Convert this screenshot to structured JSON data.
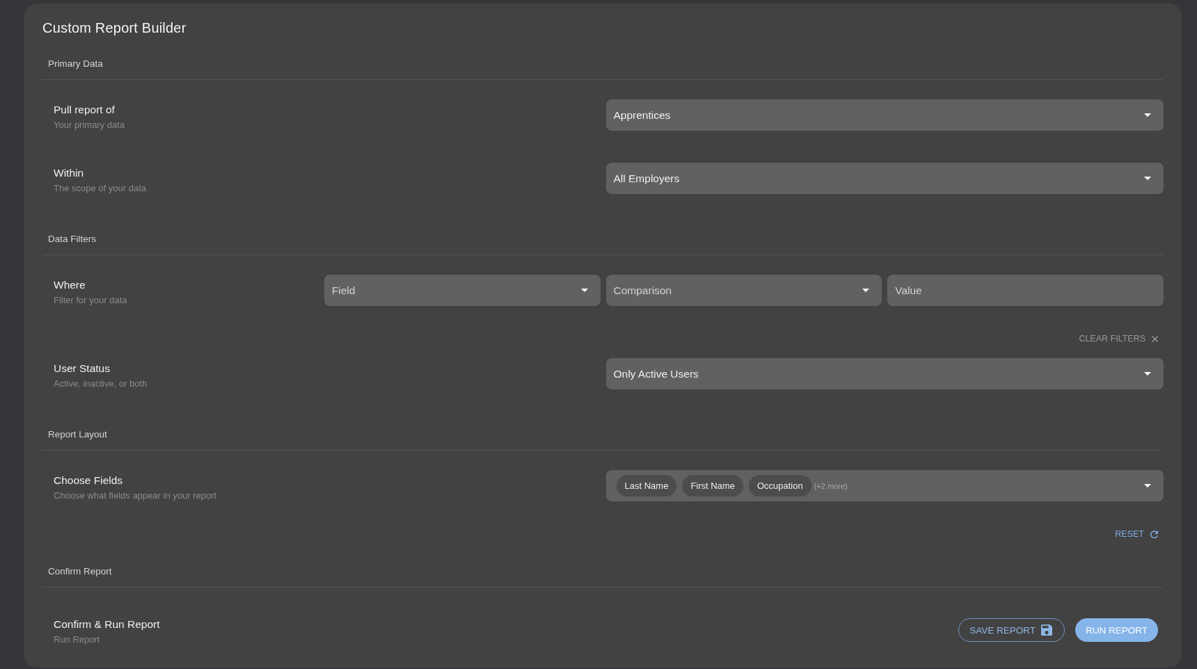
{
  "title": "Custom Report Builder",
  "sections": [
    {
      "heading": "Primary Data",
      "rows": [
        {
          "label": "Pull report of",
          "description": "Your primary data",
          "controls": [
            {
              "kind": "select",
              "value": "Apprentices"
            }
          ]
        },
        {
          "label": "Within",
          "description": "The scope of your data",
          "controls": [
            {
              "kind": "select",
              "value": "All Employers"
            }
          ]
        }
      ]
    },
    {
      "heading": "Data Filters",
      "rows": [
        {
          "label": "Where",
          "description": "Filter for your data",
          "controls": [
            {
              "kind": "select",
              "placeholder": "Field"
            },
            {
              "kind": "select",
              "placeholder": "Comparison"
            },
            {
              "kind": "input",
              "placeholder": "Value"
            }
          ],
          "action": {
            "kind": "clear",
            "label": "CLEAR FILTERS"
          }
        },
        {
          "label": "User Status",
          "description": "Active, inactive, or both",
          "controls": [
            {
              "kind": "select",
              "value": "Only Active Users"
            }
          ]
        }
      ]
    },
    {
      "heading": "Report Layout",
      "rows": [
        {
          "label": "Choose Fields",
          "description": "Choose what fields appear in your report",
          "controls": [
            {
              "kind": "multiselect",
              "chips": [
                "Last Name",
                "First Name",
                "Occupation"
              ],
              "more": "(+2 more)"
            }
          ],
          "action": {
            "kind": "reset",
            "label": "RESET"
          }
        }
      ]
    },
    {
      "heading": "Confirm Report",
      "rows": [
        {
          "label": "Confirm & Run Report",
          "description": "Run Report",
          "buttons": [
            {
              "kind": "save",
              "label": "SAVE REPORT"
            },
            {
              "kind": "run",
              "label": "RUN REPORT"
            }
          ]
        }
      ]
    }
  ]
}
